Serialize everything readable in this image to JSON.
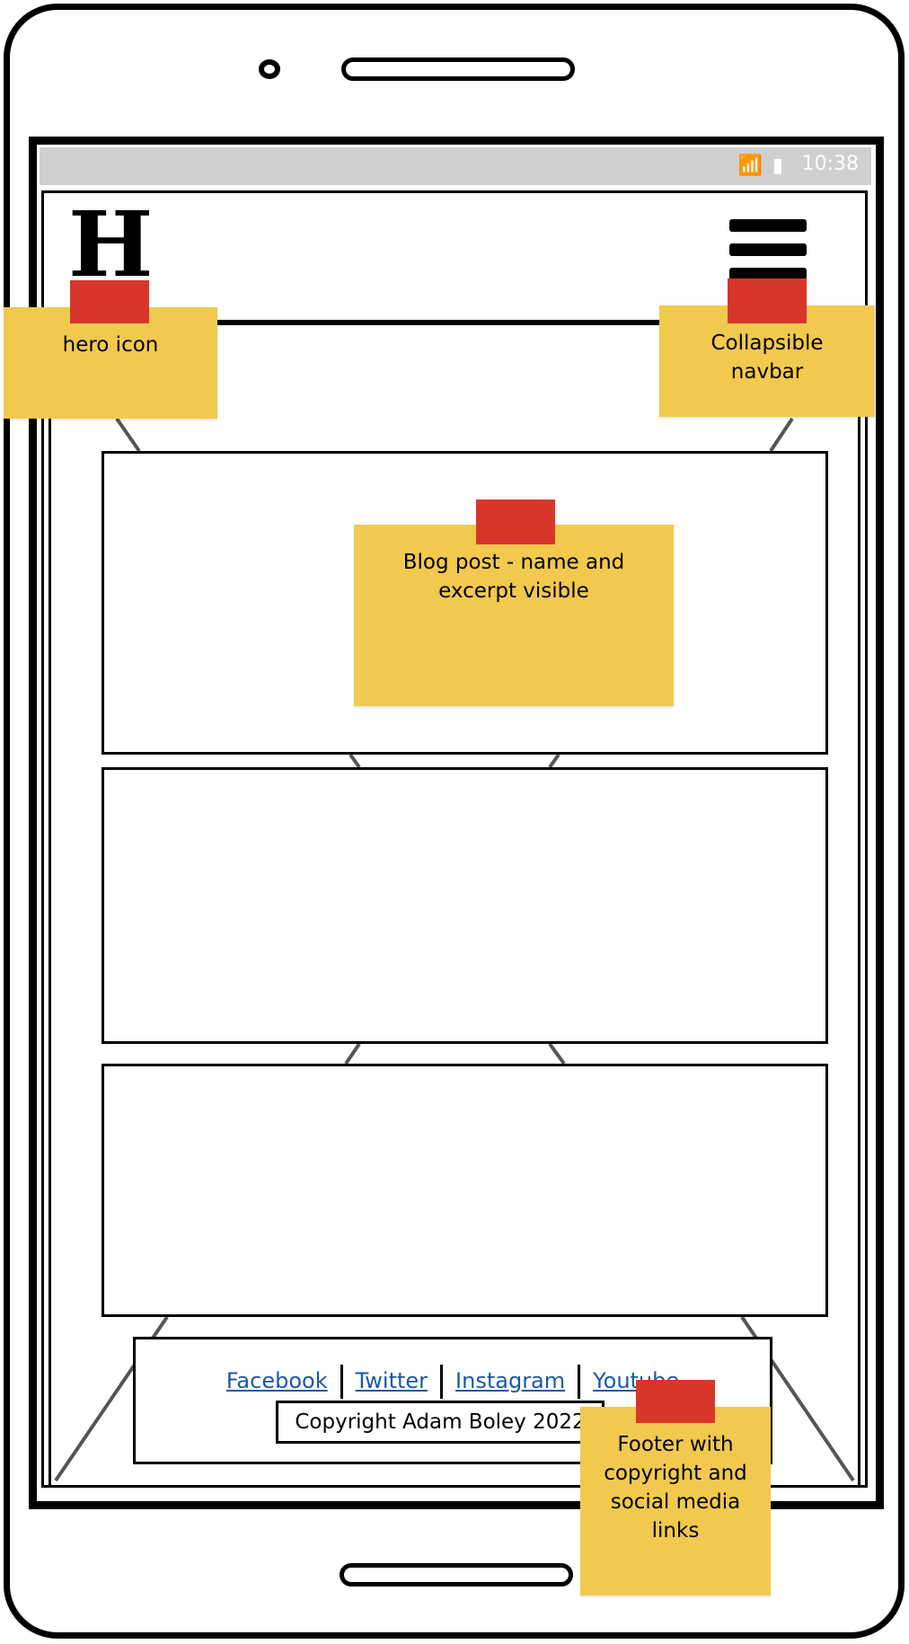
{
  "status_bar": {
    "icons": "📶 ▮",
    "time": "10:38"
  },
  "header": {
    "logo_letter": "H"
  },
  "footer": {
    "links": [
      "Facebook",
      "Twitter",
      "Instagram",
      "Youtube"
    ],
    "copyright": "Copyright Adam Boley 2022"
  },
  "annotations": {
    "hero_icon": "hero icon",
    "navbar_line1": "Collapsible",
    "navbar_line2": "navbar",
    "blog_line1": "Blog post - name and",
    "blog_line2": "excerpt visible",
    "footer_line1": "Footer with",
    "footer_line2": "copyright and",
    "footer_line3": "social media",
    "footer_line4": "links"
  },
  "colors": {
    "sticky_note": "#f1c94f",
    "tape": "#d9362b",
    "link": "#1a5aa0",
    "status_bar": "#cfcfcf"
  }
}
